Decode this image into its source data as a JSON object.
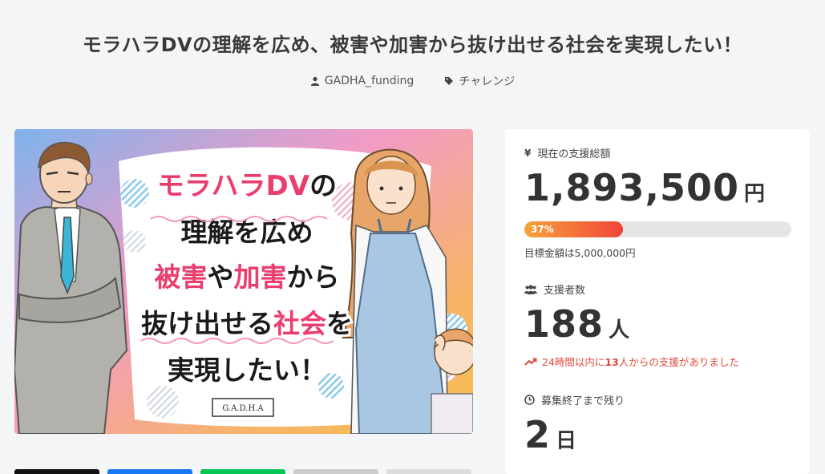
{
  "project": {
    "title": "モラハラDVの理解を広め、被害や加害から抜け出せる社会を実現したい！",
    "owner": "GADHA_funding",
    "category": "チャレンジ"
  },
  "hero_image": {
    "lines": [
      [
        {
          "t": "モラハラDV",
          "c": "pink"
        },
        {
          "t": "の",
          "c": "black"
        }
      ],
      [
        {
          "t": "理解を広め",
          "c": "black"
        }
      ],
      [
        {
          "t": "被害",
          "c": "pink"
        },
        {
          "t": "や",
          "c": "black"
        },
        {
          "t": "加害",
          "c": "pink"
        },
        {
          "t": "から",
          "c": "black"
        }
      ],
      [
        {
          "t": "抜け出せる",
          "c": "black"
        },
        {
          "t": "社会",
          "c": "pink"
        },
        {
          "t": "を",
          "c": "black"
        }
      ],
      [
        {
          "t": "実現したい！",
          "c": "black"
        }
      ]
    ],
    "logo_text": "G.A.D.H.A"
  },
  "stats": {
    "total": {
      "label": "現在の支援総額",
      "amount": "1,893,500",
      "unit": "円",
      "progress_label": "37%",
      "progress": 0.37,
      "goal": "目標金額は5,000,000円"
    },
    "supporters": {
      "label": "支援者数",
      "count": "188",
      "unit": "人",
      "trend_prefix": "24時間以内に",
      "trend_count": "13",
      "trend_suffix": "人からの支援がありました"
    },
    "remaining": {
      "label": "募集終了まで残り",
      "count": "2",
      "unit": "日"
    }
  },
  "colors": {
    "accent_pink": "#ea3e6d",
    "progress_start": "#f7a23b",
    "progress_end": "#f0443a",
    "trend_red": "#e04a3a"
  },
  "icons": {
    "owner": "user-icon",
    "category": "tag-icon",
    "total": "yen-icon",
    "supporters": "users-icon",
    "trend": "trending-up-icon",
    "remaining": "clock-icon"
  }
}
